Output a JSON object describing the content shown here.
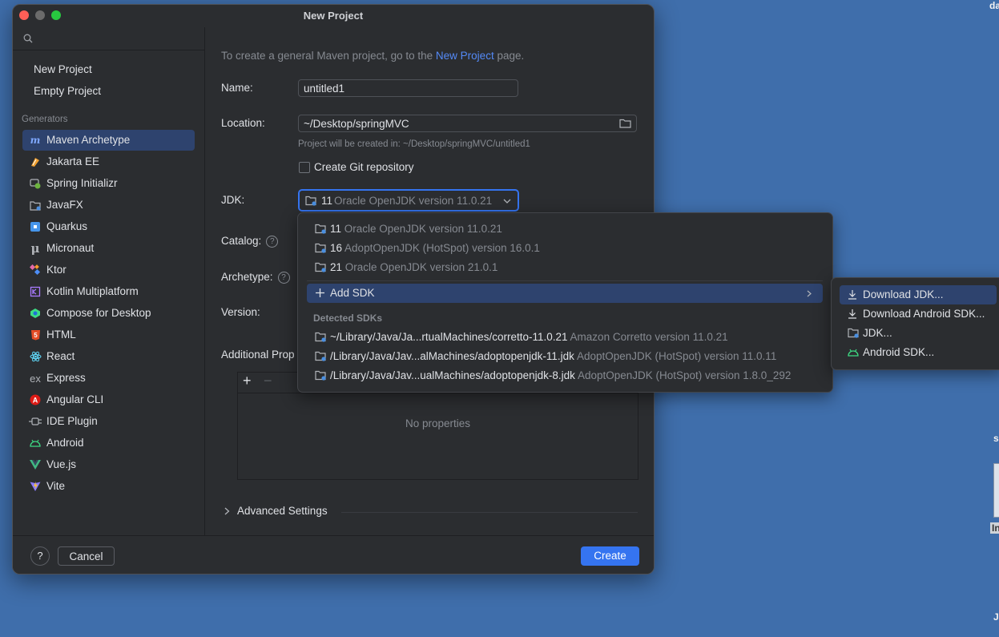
{
  "window": {
    "title": "New Project"
  },
  "sidebar": {
    "items_top": [
      {
        "label": "New Project"
      },
      {
        "label": "Empty Project"
      }
    ],
    "generators_label": "Generators",
    "generators": [
      {
        "label": "Maven Archetype",
        "icon": "maven-icon",
        "selected": true
      },
      {
        "label": "Jakarta EE",
        "icon": "jakarta-icon"
      },
      {
        "label": "Spring Initializr",
        "icon": "spring-icon"
      },
      {
        "label": "JavaFX",
        "icon": "folder-icon"
      },
      {
        "label": "Quarkus",
        "icon": "quarkus-icon"
      },
      {
        "label": "Micronaut",
        "icon": "micronaut-icon"
      },
      {
        "label": "Ktor",
        "icon": "ktor-icon"
      },
      {
        "label": "Kotlin Multiplatform",
        "icon": "kotlin-icon"
      },
      {
        "label": "Compose for Desktop",
        "icon": "compose-icon"
      },
      {
        "label": "HTML",
        "icon": "html5-icon"
      },
      {
        "label": "React",
        "icon": "react-icon"
      },
      {
        "label": "Express",
        "icon": "express-icon"
      },
      {
        "label": "Angular CLI",
        "icon": "angular-icon"
      },
      {
        "label": "IDE Plugin",
        "icon": "plugin-icon"
      },
      {
        "label": "Android",
        "icon": "android-icon"
      },
      {
        "label": "Vue.js",
        "icon": "vue-icon"
      },
      {
        "label": "Vite",
        "icon": "vite-icon"
      }
    ]
  },
  "main": {
    "hint_prefix": "To create a general Maven project, go to the ",
    "hint_link": "New Project",
    "hint_suffix": " page.",
    "name_label": "Name:",
    "name_value": "untitled1",
    "location_label": "Location:",
    "location_value": "~/Desktop/springMVC",
    "location_hint": "Project will be created in: ~/Desktop/springMVC/untitled1",
    "git_label": "Create Git repository",
    "jdk_label": "JDK:",
    "jdk_version": "11",
    "jdk_name": "Oracle OpenJDK version 11.0.21",
    "catalog_label": "Catalog:",
    "archetype_label": "Archetype:",
    "version_label": "Version:",
    "additional_label": "Additional Prop",
    "no_properties": "No properties",
    "add_symbol": "+",
    "remove_symbol": "−",
    "advanced_label": "Advanced Settings"
  },
  "footer": {
    "help": "?",
    "cancel": "Cancel",
    "create": "Create"
  },
  "popup": {
    "jdks": [
      {
        "version": "11",
        "name": "Oracle OpenJDK version 11.0.21"
      },
      {
        "version": "16",
        "name": "AdoptOpenJDK (HotSpot) version 16.0.1"
      },
      {
        "version": "21",
        "name": "Oracle OpenJDK version 21.0.1"
      }
    ],
    "add_sdk": "Add SDK",
    "detected_label": "Detected SDKs",
    "detected": [
      {
        "path": "~/Library/Java/Ja...rtualMachines/corretto-11.0.21",
        "name": "Amazon Corretto version 11.0.21"
      },
      {
        "path": "/Library/Java/Jav...alMachines/adoptopenjdk-11.jdk",
        "name": "AdoptOpenJDK (HotSpot) version 11.0.11"
      },
      {
        "path": "/Library/Java/Jav...ualMachines/adoptopenjdk-8.jdk",
        "name": "AdoptOpenJDK (HotSpot) version 1.8.0_292"
      }
    ]
  },
  "submenu": {
    "items": [
      {
        "label": "Download JDK...",
        "icon": "download-icon"
      },
      {
        "label": "Download Android SDK...",
        "icon": "download-icon"
      },
      {
        "label": "JDK...",
        "icon": "folder-icon"
      },
      {
        "label": "Android SDK...",
        "icon": "android-icon"
      }
    ]
  },
  "desktop": {
    "frag1": "da",
    "frag2": "s",
    "frag3": "In",
    "frag4": "J"
  },
  "colors": {
    "accent": "#3574f0",
    "selection": "#2e436e",
    "background": "#2b2d30",
    "desktop": "#3f6eab"
  }
}
